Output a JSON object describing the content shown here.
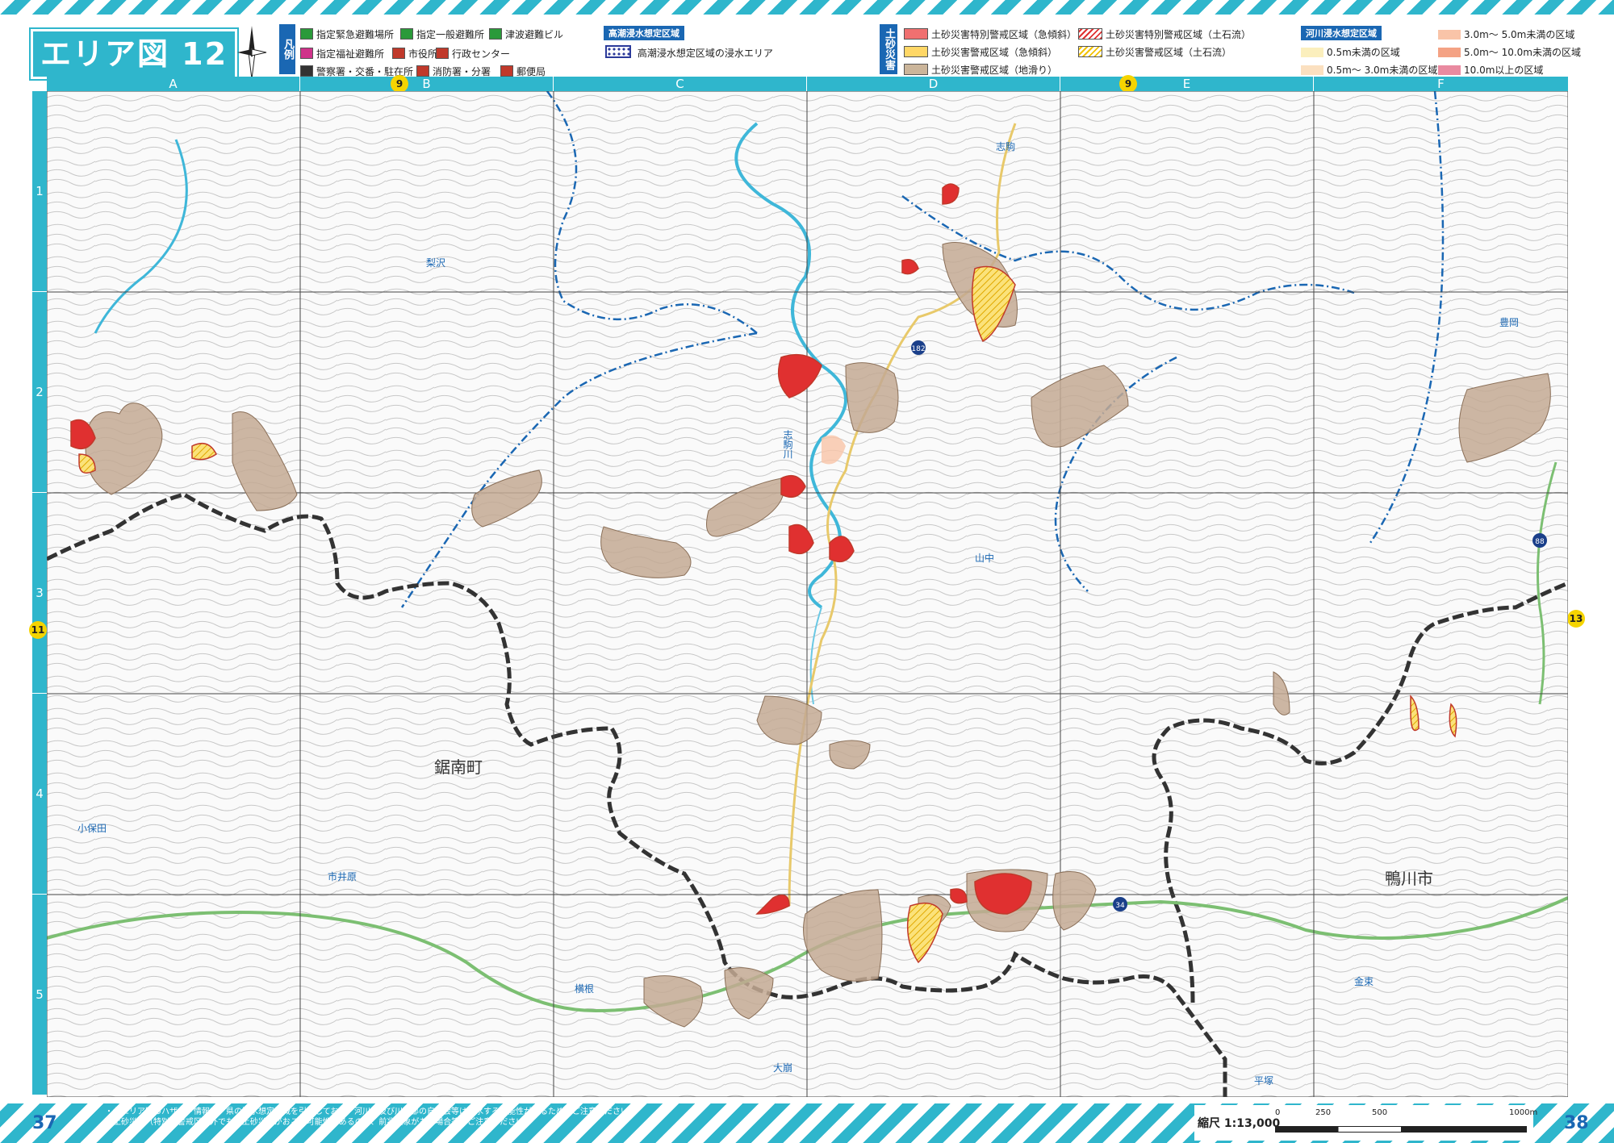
{
  "title": "エリア図 12",
  "legend": {
    "tag": "凡例",
    "items": [
      {
        "label": "指定緊急避難場所",
        "color": "#2a9a3a"
      },
      {
        "label": "指定一般避難所",
        "color": "#2a9a3a"
      },
      {
        "label": "津波避難ビル",
        "color": "#2a9a3a"
      },
      {
        "label": "指定福祉避難所",
        "color": "#d0338a"
      },
      {
        "label": "市役所",
        "color": "#c0392b"
      },
      {
        "label": "行政センター",
        "color": "#c0392b"
      },
      {
        "label": "警察署・交番・駐在所",
        "color": "#333333"
      },
      {
        "label": "消防署・分署",
        "color": "#c0392b"
      },
      {
        "label": "郵便局",
        "color": "#c0392b"
      }
    ]
  },
  "flood_tide": {
    "header": "高潮浸水想定区域",
    "item": "高潮浸水想定区域の浸水エリア"
  },
  "sediment": {
    "tag": "土砂災害",
    "items": [
      {
        "label": "土砂災害特別警戒区域（急傾斜）",
        "color": "#f07070"
      },
      {
        "label": "土砂災害特別警戒区域（土石流）",
        "color": "#e03030"
      },
      {
        "label": "土砂災害警戒区域（急傾斜）",
        "color": "#ffd766"
      },
      {
        "label": "土砂災害警戒区域（土石流）",
        "color": "#f2c200"
      },
      {
        "label": "土砂災害警戒区域（地滑り）",
        "color": "#cbb59a"
      }
    ]
  },
  "river_flood": {
    "header": "河川浸水想定区域",
    "items": [
      {
        "label": "0.5m未満の区域",
        "color": "#fbefbd"
      },
      {
        "label": "0.5m～ 3.0m未満の区域",
        "color": "#fbe0c0"
      },
      {
        "label": "3.0m～ 5.0m未満の区域",
        "color": "#f9c4a8"
      },
      {
        "label": "5.0m～ 10.0m未満の区域",
        "color": "#f4a284"
      },
      {
        "label": "10.0m以上の区域",
        "color": "#e98aa0"
      }
    ]
  },
  "columns": [
    "A",
    "B",
    "C",
    "D",
    "E",
    "F"
  ],
  "rows": [
    "1",
    "2",
    "3",
    "4",
    "5"
  ],
  "adjacent_markers": {
    "top_b": "9",
    "top_e": "9",
    "left": "11",
    "right": "13"
  },
  "places": [
    {
      "name": "梨沢",
      "kind": "blue"
    },
    {
      "name": "志駒",
      "kind": "blue"
    },
    {
      "name": "豊岡",
      "kind": "blue"
    },
    {
      "name": "山中",
      "kind": "blue"
    },
    {
      "name": "鋸南町",
      "kind": "big"
    },
    {
      "name": "小保田",
      "kind": "blue"
    },
    {
      "name": "市井原",
      "kind": "blue"
    },
    {
      "name": "横根",
      "kind": "blue"
    },
    {
      "name": "大崩",
      "kind": "blue"
    },
    {
      "name": "平塚",
      "kind": "blue"
    },
    {
      "name": "金束",
      "kind": "blue"
    },
    {
      "name": "鴨川市",
      "kind": "big"
    },
    {
      "name": "志駒川",
      "kind": "blue"
    }
  ],
  "road_numbers": [
    "182",
    "88",
    "34"
  ],
  "page_left": "37",
  "page_right": "38",
  "footnote_1": "・各エリア図のハザード情報は、県の浸水想定区域を引用しており、河川部及び川沿部の自治会等は浸水する可能性があるため、ご注意ください。",
  "footnote_2": "・土砂災害（特別）警戒区域外でも、土砂災害がおこる可能性があるので、前兆現象がある場合等、ご注意ください。",
  "scale": {
    "label": "縮尺 1:13,000",
    "ticks": [
      "0",
      "250",
      "500",
      "1000m"
    ]
  }
}
